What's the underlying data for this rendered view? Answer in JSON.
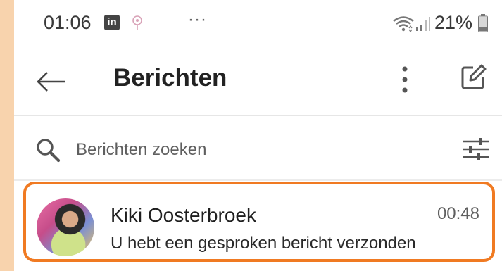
{
  "status_bar": {
    "time": "01:06",
    "app_badge": "in",
    "overflow": "···",
    "battery": "21%",
    "icons": [
      "linkedin-icon",
      "flower-icon",
      "wifi-icon",
      "signal-icon",
      "battery-icon"
    ]
  },
  "header": {
    "title": "Berichten",
    "icons": [
      "back-arrow-icon",
      "more-vertical-icon",
      "compose-icon"
    ]
  },
  "search": {
    "placeholder": "Berichten zoeken",
    "icons": [
      "search-icon",
      "filter-sliders-icon"
    ]
  },
  "conversations": [
    {
      "name": "Kiki Oosterbroek",
      "time": "00:48",
      "preview": "U hebt een gesproken bericht verzonden",
      "highlighted": true
    }
  ],
  "colors": {
    "background": "#f8d3ad",
    "highlight_border": "#f07a22",
    "text_primary": "#222222",
    "text_secondary": "#5f5f5f"
  }
}
